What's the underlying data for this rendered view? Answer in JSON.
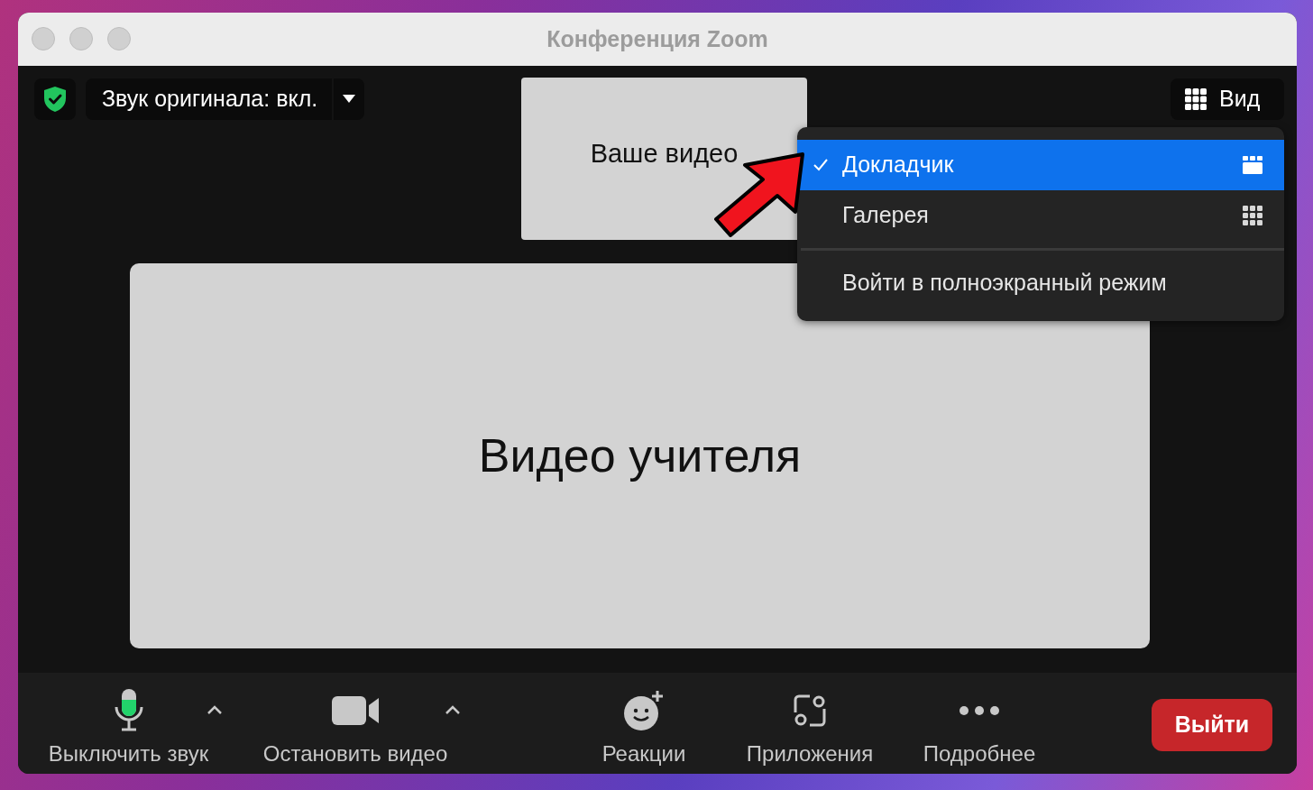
{
  "window": {
    "title": "Конференция Zoom"
  },
  "top_bar": {
    "original_sound": {
      "label": "Звук оригинала: вкл."
    },
    "view_button": {
      "label": "Вид"
    }
  },
  "videos": [
    {
      "kind": "thumbnail",
      "label": "Ваше видео"
    },
    {
      "kind": "main",
      "label": "Видео учителя"
    }
  ],
  "view_menu": {
    "items": [
      {
        "label": "Докладчик",
        "selected": true,
        "kind": "speaker"
      },
      {
        "label": "Галерея",
        "selected": false,
        "kind": "gallery"
      }
    ],
    "fullscreen": {
      "label": "Войти в полноэкранный режим"
    }
  },
  "toolbar": {
    "items": [
      {
        "kind": "mic",
        "label": "Выключить звук",
        "has_caret": true
      },
      {
        "kind": "camera",
        "label": "Остановить видео",
        "has_caret": true
      },
      {
        "kind": "reactions",
        "label": "Реакции",
        "has_caret": false
      },
      {
        "kind": "apps",
        "label": "Приложения",
        "has_caret": false
      },
      {
        "kind": "more",
        "label": "Подробнее",
        "has_caret": false
      }
    ],
    "leave": {
      "label": "Выйти"
    }
  }
}
